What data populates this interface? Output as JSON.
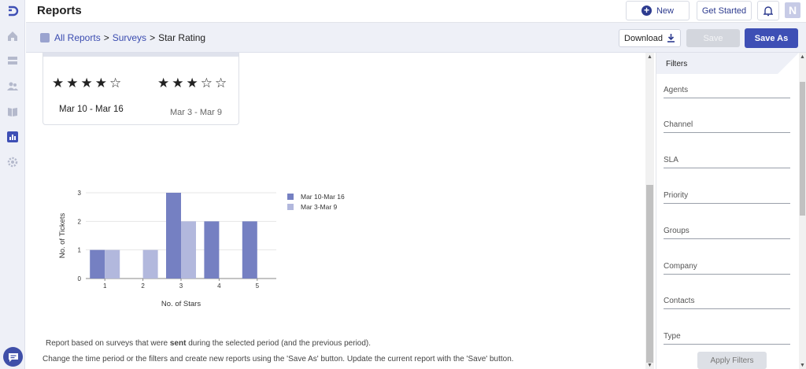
{
  "header": {
    "title": "Reports",
    "new_label": "New",
    "get_started_label": "Get Started",
    "avatar_initial": "N"
  },
  "breadcrumb": {
    "all_reports": "All Reports",
    "sep1": ">",
    "surveys": "Surveys",
    "sep2": ">",
    "current": "Star Rating"
  },
  "toolbar": {
    "download_label": "Download",
    "save_label": "Save",
    "save_as_label": "Save As"
  },
  "summary_card": {
    "current": {
      "stars": "★★★★☆",
      "rating": 4,
      "range": "Mar 10 - Mar 16"
    },
    "previous": {
      "stars": "★★★☆☆",
      "rating": 3,
      "range": "Mar 3 - Mar 9"
    }
  },
  "chart_data": {
    "type": "bar",
    "categories": [
      "1",
      "2",
      "3",
      "4",
      "5"
    ],
    "series": [
      {
        "name": "Mar 10-Mar 16",
        "values": [
          1,
          0,
          3,
          2,
          2
        ],
        "color": "#7580c2"
      },
      {
        "name": "Mar 3-Mar 9",
        "values": [
          1,
          1,
          2,
          0,
          0
        ],
        "color": "#b2b8dd"
      }
    ],
    "yticks": [
      "0",
      "1",
      "2",
      "3"
    ],
    "ylim": [
      0,
      3
    ],
    "xlabel": "No. of Stars",
    "ylabel": "No. of Tickets",
    "legend_position": "right",
    "grid": true
  },
  "notes": {
    "line1_prefix": "Report based on surveys that were ",
    "line1_bold": "sent",
    "line1_suffix": " during the selected period (and the previous period).",
    "line2": "Change the time period or the filters and create new reports using the 'Save As' button. Update the current report with the 'Save' button."
  },
  "filters": {
    "title": "Filters",
    "fields": [
      "Agents",
      "Channel",
      "SLA",
      "Priority",
      "Groups",
      "Company",
      "Contacts",
      "Type"
    ],
    "apply_label": "Apply Filters"
  },
  "colors": {
    "accent": "#3e4fb5",
    "series1": "#7580c2",
    "series2": "#b2b8dd"
  }
}
